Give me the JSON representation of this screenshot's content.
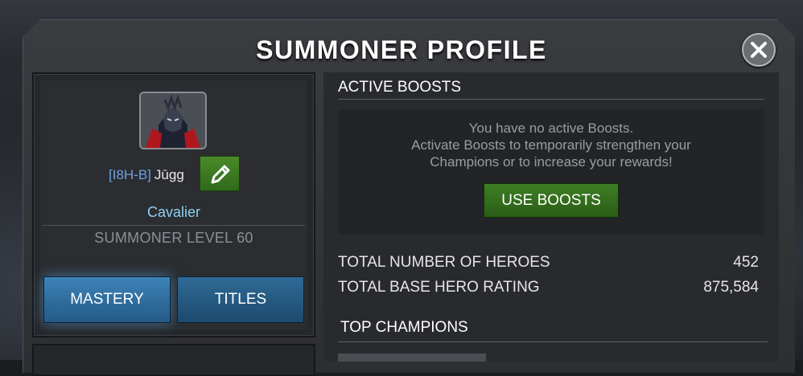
{
  "modal": {
    "title": "SUMMONER PROFILE"
  },
  "profile": {
    "alliance_tag": "[I8H-B]",
    "name": "Jūgg",
    "summoner_title": "Cavalier",
    "level_text": "SUMMONER LEVEL 60",
    "tabs": [
      {
        "label": "MASTERY",
        "selected": true
      },
      {
        "label": "TITLES",
        "selected": false
      }
    ]
  },
  "boosts": {
    "heading": "ACTIVE BOOSTS",
    "message_line1": "You have no active Boosts.",
    "message_line2": "Activate Boosts to temporarily strengthen your",
    "message_line3": "Champions or to increase your rewards!",
    "button_label": "USE BOOSTS"
  },
  "stats": [
    {
      "label": "TOTAL NUMBER OF HEROES",
      "value": "452"
    },
    {
      "label": "TOTAL BASE HERO RATING",
      "value": "875,584"
    }
  ],
  "top_champions": {
    "heading": "TOP CHAMPIONS"
  },
  "icons": {
    "close": "close-icon",
    "edit": "pencil-icon"
  },
  "colors": {
    "accent_green": "#3e7f25",
    "tab_blue": "#3d83b8",
    "alliance_tag": "#6aa0e0",
    "title_cyan": "#8fd0f0"
  }
}
